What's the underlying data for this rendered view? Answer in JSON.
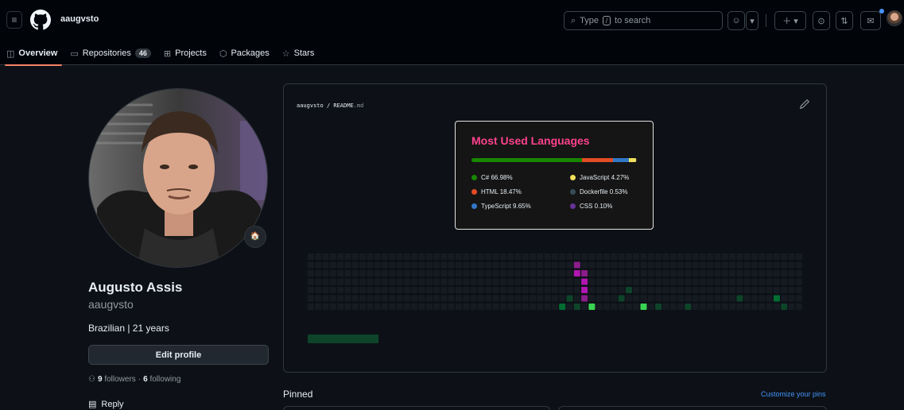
{
  "header": {
    "username": "aaugvsto",
    "search_placeholder_pre": "Type",
    "search_placeholder_key": "/",
    "search_placeholder_post": "to search"
  },
  "tabs": [
    {
      "label": "Overview",
      "icon": "book-icon",
      "active": true
    },
    {
      "label": "Repositories",
      "icon": "repo-icon",
      "count": "46"
    },
    {
      "label": "Projects",
      "icon": "table-icon"
    },
    {
      "label": "Packages",
      "icon": "package-icon"
    },
    {
      "label": "Stars",
      "icon": "star-icon"
    }
  ],
  "profile": {
    "name": "Augusto Assis",
    "login": "aaugvsto",
    "bio": "Brazilian | 21 years",
    "edit_label": "Edit profile",
    "followers_count": "9",
    "followers_label": "followers",
    "following_count": "6",
    "following_label": "following",
    "reply_label": "Reply"
  },
  "readme": {
    "owner": "aaugvsto",
    "sep": "/",
    "file": "README",
    "ext": ".md"
  },
  "languages": {
    "title": "Most Used Languages",
    "items": [
      {
        "label": "C# 66.98%",
        "pct": 66.98,
        "color": "#178600"
      },
      {
        "label": "HTML 18.47%",
        "pct": 18.47,
        "color": "#e34c26"
      },
      {
        "label": "TypeScript 9.65%",
        "pct": 9.65,
        "color": "#3178c6"
      },
      {
        "label": "JavaScript 4.27%",
        "pct": 4.27,
        "color": "#f1e05a"
      },
      {
        "label": "Dockerfile 0.53%",
        "pct": 0.53,
        "color": "#384d54"
      },
      {
        "label": "CSS 0.10%",
        "pct": 0.1,
        "color": "#663399"
      }
    ]
  },
  "contributions": {
    "weeks": 53,
    "colors": [
      "#161b22",
      "#0e4429",
      "#006d32",
      "#26a641",
      "#39d353",
      "#8b1d8b",
      "#b016b0"
    ],
    "cells": [
      [
        36,
        1,
        5
      ],
      [
        36,
        2,
        6
      ],
      [
        37,
        2,
        5
      ],
      [
        37,
        3,
        6
      ],
      [
        37,
        4,
        6
      ],
      [
        37,
        5,
        5
      ],
      [
        34,
        6,
        2
      ],
      [
        35,
        5,
        1
      ],
      [
        36,
        6,
        1
      ],
      [
        38,
        6,
        4
      ],
      [
        42,
        5,
        1
      ],
      [
        43,
        4,
        1
      ],
      [
        45,
        6,
        4
      ],
      [
        46,
        7,
        1
      ],
      [
        47,
        6,
        1
      ],
      [
        51,
        6,
        1
      ],
      [
        58,
        5,
        1
      ],
      [
        63,
        5,
        2
      ],
      [
        64,
        6,
        1
      ],
      [
        68,
        1,
        2
      ]
    ]
  },
  "pinned": {
    "title": "Pinned",
    "customize_label": "Customize your pins"
  },
  "colors": {
    "accent_tab": "#f78166",
    "link": "#4493f8",
    "lang_title": "#fe428e"
  }
}
